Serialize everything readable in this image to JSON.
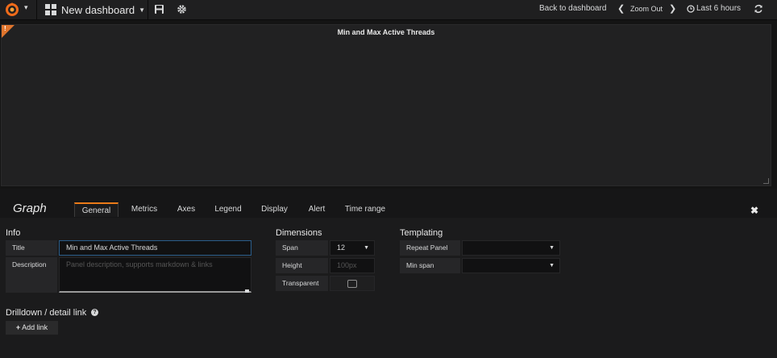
{
  "navbar": {
    "dashboard_title": "New dashboard",
    "back_to_dashboard": "Back to dashboard",
    "zoom_out": "Zoom Out",
    "time_range": "Last 6 hours"
  },
  "panel": {
    "title": "Min and Max Active Threads",
    "alert_mark": "!"
  },
  "editor": {
    "panel_type": "Graph",
    "tabs": [
      {
        "label": "General",
        "active": true
      },
      {
        "label": "Metrics",
        "active": false
      },
      {
        "label": "Axes",
        "active": false
      },
      {
        "label": "Legend",
        "active": false
      },
      {
        "label": "Display",
        "active": false
      },
      {
        "label": "Alert",
        "active": false
      },
      {
        "label": "Time range",
        "active": false
      }
    ],
    "info": {
      "heading": "Info",
      "title_label": "Title",
      "title_value": "Min and Max Active Threads",
      "description_label": "Description",
      "description_placeholder": "Panel description, supports markdown & links"
    },
    "dimensions": {
      "heading": "Dimensions",
      "span_label": "Span",
      "span_value": "12",
      "height_label": "Height",
      "height_placeholder": "100px",
      "transparent_label": "Transparent",
      "transparent_checked": false
    },
    "templating": {
      "heading": "Templating",
      "repeat_panel_label": "Repeat Panel",
      "repeat_panel_value": "",
      "min_span_label": "Min span",
      "min_span_value": ""
    },
    "drilldown": {
      "heading": "Drilldown / detail link",
      "add_link_label": "Add link"
    }
  },
  "colors": {
    "accent_orange": "#eb7b18",
    "panel_bg": "#212122",
    "page_bg": "#141414",
    "focus_blue": "#2a5d8a"
  }
}
